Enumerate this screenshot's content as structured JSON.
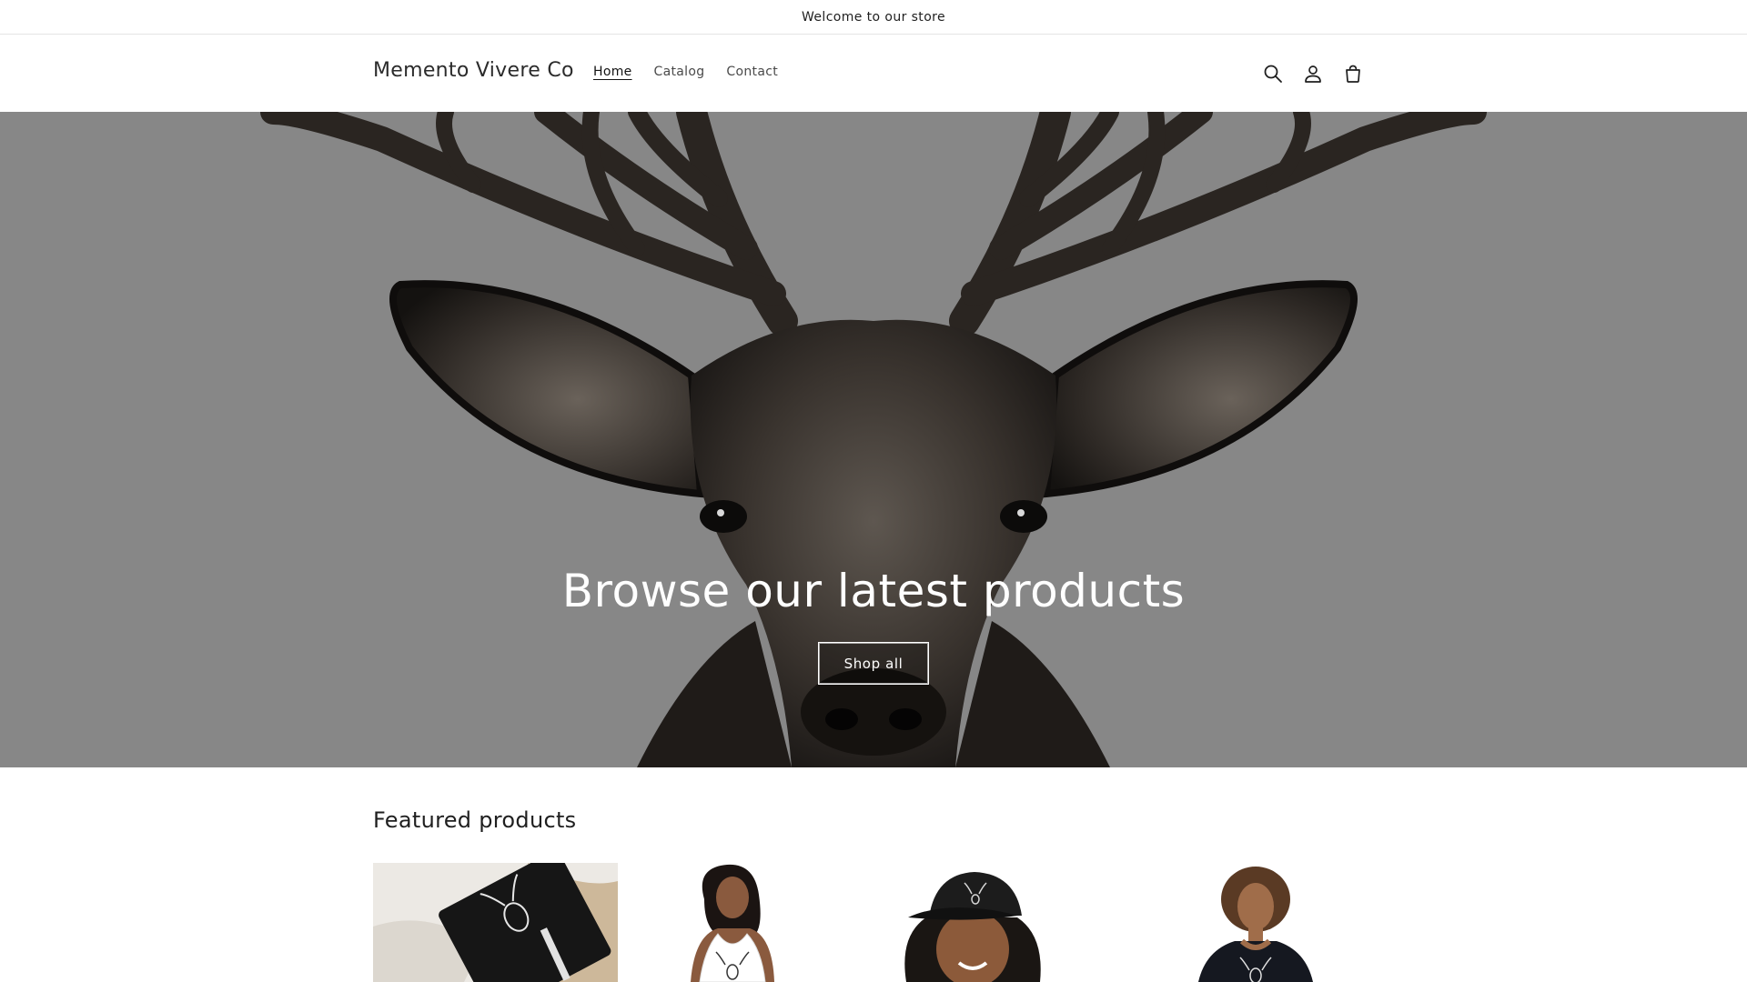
{
  "announcement": {
    "text": "Welcome to our store"
  },
  "header": {
    "logo": "Memento Vivere Co",
    "nav": [
      {
        "label": "Home",
        "active": true
      },
      {
        "label": "Catalog",
        "active": false
      },
      {
        "label": "Contact",
        "active": false
      }
    ],
    "icons": [
      "search-icon",
      "account-icon",
      "cart-icon"
    ]
  },
  "hero": {
    "title": "Browse our latest products",
    "button_label": "Shop all",
    "background_color": "#878787"
  },
  "featured": {
    "title": "Featured products",
    "products": [
      {
        "image": "journal-notebook-image"
      },
      {
        "image": "tank-top-model-image"
      },
      {
        "image": "cap-model-image"
      },
      {
        "image": "tshirt-model-image"
      }
    ]
  }
}
